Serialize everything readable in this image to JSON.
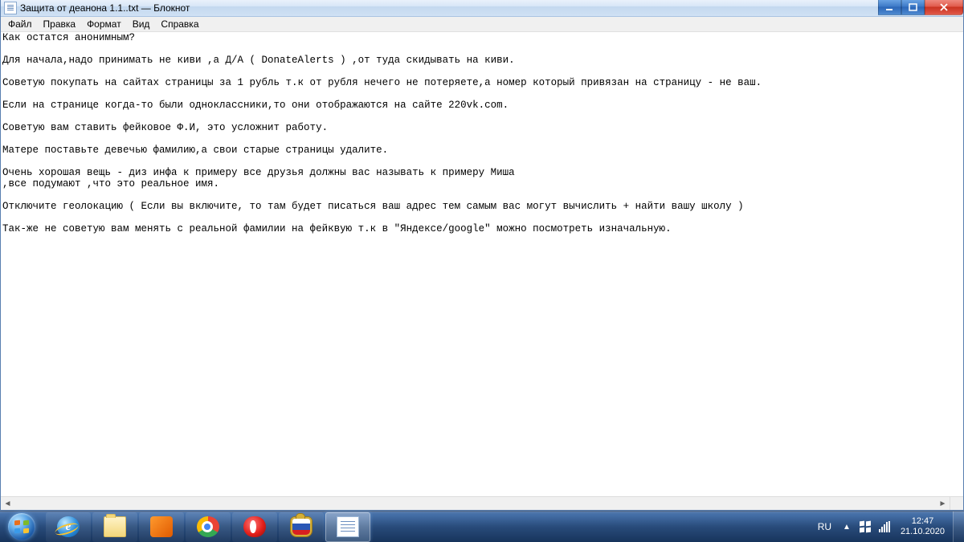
{
  "window": {
    "title": "Защита от деанона 1.1..txt — Блокнот"
  },
  "menu": {
    "file": "Файл",
    "edit": "Правка",
    "format": "Формат",
    "view": "Вид",
    "help": "Справка"
  },
  "document": {
    "lines": [
      "Как остатся анонимным?",
      "",
      "Для начала,надо принимать не киви ,а Д/А ( DonateAlerts ) ,от туда скидывать на киви.",
      "",
      "Советую покупать на сайтах страницы за 1 рубль т.к от рубля нечего не потеряете,а номер который привязан на страницу - не ваш.",
      "",
      "Если на странице когда-то были одноклассники,то они отображаются на сайте 220vk.com.",
      "",
      "Советую вам ставить фейковое Ф.И, это усложнит работу.",
      "",
      "Матере поставьте девечью фамилию,а свои старые страницы удалите.",
      "",
      "Очень хорошая вещь - диз инфа к примеру все друзья должны вас называть к примеру Миша",
      ",все подумают ,что это реальное имя.",
      "",
      "Отключите геолокацию ( Если вы включите, то там будет писаться ваш адрес тем самым вас могут вычислить + найти вашу школу )",
      "",
      "Так-же не советую вам менять с реальной фамилии на фейквую т.к в \"Яндексе/google\" можно посмотреть изначальную."
    ]
  },
  "tray": {
    "lang": "RU",
    "time": "12:47",
    "date": "21.10.2020"
  }
}
